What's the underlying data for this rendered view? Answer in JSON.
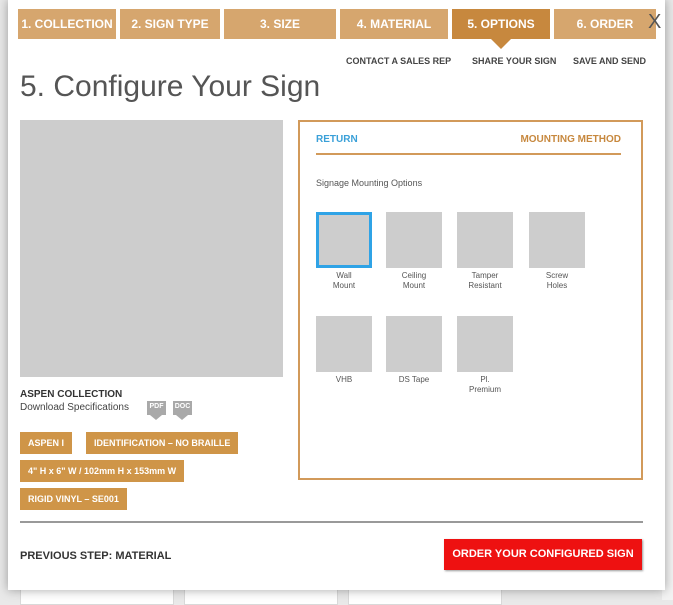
{
  "steps": [
    "1. COLLECTION",
    "2. SIGN TYPE",
    "3. SIZE",
    "4. MATERIAL",
    "5. OPTIONS",
    "6. ORDER"
  ],
  "close_label": "X",
  "top_links": {
    "contact": "CONTACT A SALES REP",
    "share": "SHARE YOUR SIGN",
    "save": "SAVE AND SEND"
  },
  "page_title": "5. Configure Your Sign",
  "collection_name": "ASPEN COLLECTION",
  "download_label": "Download Specifications",
  "doc_tags": [
    "PDF",
    "DOC"
  ],
  "summary_tags": [
    "ASPEN I",
    "IDENTIFICATION – NO BRAILLE",
    "4\" H x 6\" W / 102mm H x 153mm W",
    "RIGID VINYL – SE001"
  ],
  "panel": {
    "return_label": "RETURN",
    "heading": "MOUNTING METHOD",
    "subheading": "Signage Mounting Options",
    "options": [
      {
        "label": "Wall\nMount",
        "selected": true
      },
      {
        "label": "Ceiling\nMount"
      },
      {
        "label": "Tamper\nResistant"
      },
      {
        "label": "Screw\nHoles"
      },
      {
        "label": "VHB"
      },
      {
        "label": "DS Tape"
      },
      {
        "label": "Pl.\nPremium"
      }
    ]
  },
  "previous_step": "PREVIOUS STEP: MATERIAL",
  "order_button": "ORDER YOUR CONFIGURED SIGN",
  "colors": {
    "step_bg": "#d6a66e",
    "step_active": "#c7883e",
    "accent_blue": "#2fa3e6",
    "order_red": "#ee1111"
  }
}
